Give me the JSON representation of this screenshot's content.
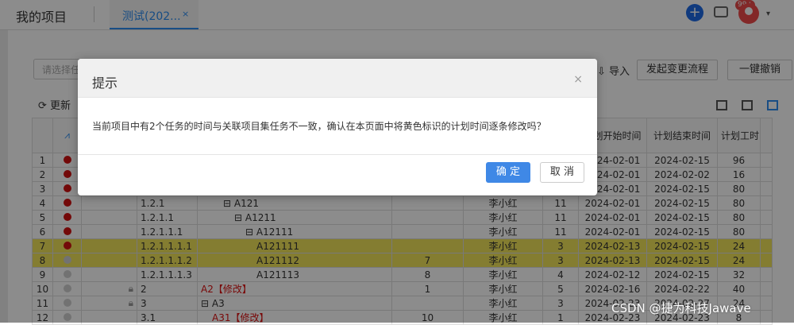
{
  "header": {
    "app_title": "我的项目",
    "tab_label": "测试(202...",
    "tab_close": "×",
    "add": "+",
    "badge": "99+",
    "caret": "▾"
  },
  "toolbar": {
    "select_placeholder": "请选择任",
    "import": "导入",
    "change_flow": "发起变更流程",
    "undo": "一键撤销",
    "refresh": "更新"
  },
  "table": {
    "headers": {
      "plan_start": "计划开始时间",
      "plan_end": "计划结束时间",
      "plan_hours": "计划工时"
    },
    "rows": [
      {
        "n": "1",
        "dot": "red",
        "code": "",
        "name": "",
        "num": "",
        "owner": "",
        "dur": "",
        "start": "2024-02-01",
        "end": "2024-02-15",
        "hours": "96",
        "hl": false,
        "plus": false
      },
      {
        "n": "2",
        "dot": "red",
        "code": "",
        "name": "",
        "num": "",
        "owner": "",
        "dur": "",
        "start": "2024-02-01",
        "end": "2024-02-02",
        "hours": "16",
        "hl": false,
        "plus": false
      },
      {
        "n": "3",
        "dot": "red",
        "code": "",
        "name": "",
        "num": "",
        "owner": "",
        "dur": "",
        "start": "2024-02-01",
        "end": "2024-02-15",
        "hours": "80",
        "hl": false,
        "plus": false
      },
      {
        "n": "4",
        "dot": "red",
        "code": "1.2.1",
        "name": "⊟ A121",
        "num": "",
        "owner": "李小红",
        "dur": "11",
        "start": "2024-02-01",
        "end": "2024-02-15",
        "hours": "80",
        "hl": false,
        "plus": false
      },
      {
        "n": "5",
        "dot": "red",
        "code": "1.2.1.1",
        "name": "⊟ A1211",
        "num": "",
        "owner": "李小红",
        "dur": "11",
        "start": "2024-02-01",
        "end": "2024-02-15",
        "hours": "80",
        "hl": false,
        "plus": false
      },
      {
        "n": "6",
        "dot": "red",
        "code": "1.2.1.1.1",
        "name": "⊟ A12111",
        "num": "",
        "owner": "李小红",
        "dur": "11",
        "start": "2024-02-01",
        "end": "2024-02-15",
        "hours": "80",
        "hl": false,
        "plus": false
      },
      {
        "n": "7",
        "dot": "red",
        "code": "1.2.1.1.1.1",
        "name": "A121111",
        "num": "",
        "owner": "李小红",
        "dur": "3",
        "start": "2024-02-13",
        "end": "2024-02-15",
        "hours": "24",
        "hl": true,
        "plus": false
      },
      {
        "n": "8",
        "dot": "grey",
        "code": "1.2.1.1.1.2",
        "name": "A121112",
        "num": "7",
        "owner": "李小红",
        "dur": "3",
        "start": "2024-02-13",
        "end": "2024-02-15",
        "hours": "24",
        "hl": true,
        "plus": false
      },
      {
        "n": "9",
        "dot": "grey",
        "code": "1.2.1.1.1.3",
        "name": "A121113",
        "num": "8",
        "owner": "李小红",
        "dur": "4",
        "start": "2024-02-12",
        "end": "2024-02-15",
        "hours": "32",
        "hl": false,
        "plus": false
      },
      {
        "n": "10",
        "dot": "grey",
        "code": "2",
        "name": "A2【修改】",
        "num": "1",
        "owner": "李小红",
        "dur": "5",
        "start": "2024-02-16",
        "end": "2024-02-22",
        "hours": "40",
        "hl": false,
        "plus": true
      },
      {
        "n": "11",
        "dot": "grey",
        "code": "3",
        "name": "⊟ A3",
        "num": "",
        "owner": "李小红",
        "dur": "3",
        "start": "2024-02-23",
        "end": "2024-02-27",
        "hours": "24",
        "hl": false,
        "plus": true
      },
      {
        "n": "12",
        "dot": "grey",
        "code": "3.1",
        "name": "A31【修改】",
        "num": "10",
        "owner": "李小红",
        "dur": "1",
        "start": "2024-02-23",
        "end": "2024-02-23",
        "hours": "8",
        "hl": false,
        "plus": false
      }
    ]
  },
  "dialog": {
    "title": "提示",
    "close": "×",
    "message": "当前项目中有2个任务的时间与关联项目集任务不一致，确认在本页面中将黄色标识的计划时间逐条修改吗？",
    "ok": "确 定",
    "cancel": "取 消"
  },
  "watermark": "CSDN @捷为科技Jawave",
  "colors": {
    "primary": "#3f88e6",
    "highlight": "#f0e35a",
    "danger": "#d11111"
  }
}
